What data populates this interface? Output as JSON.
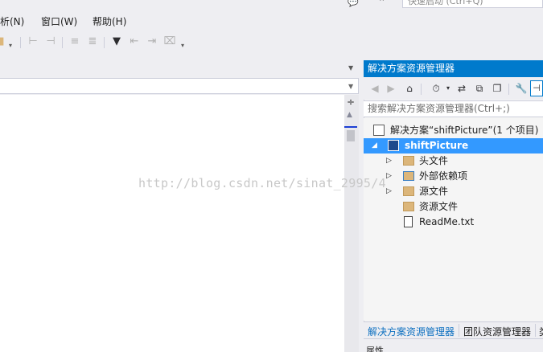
{
  "quick_launch": {
    "placeholder": "快速启动 (Ctrl+Q)"
  },
  "menu": [
    {
      "label": "析(N)"
    },
    {
      "label": "窗口(W)"
    },
    {
      "label": "帮助(H)"
    }
  ],
  "editor": {},
  "solution_explorer": {
    "title": "解决方案资源管理器",
    "search_placeholder": "搜索解决方案资源管理器(Ctrl+;)",
    "tree": [
      {
        "label": "解决方案“shiftPicture”(1 个项目)",
        "icon": "solution-icon"
      },
      {
        "label": "shiftPicture",
        "icon": "cpp-project-icon",
        "selected": true,
        "expanded": true
      },
      {
        "label": "头文件",
        "icon": "folder-icon",
        "expandable": true
      },
      {
        "label": "外部依赖项",
        "icon": "external-deps-icon",
        "expandable": true
      },
      {
        "label": "源文件",
        "icon": "folder-icon",
        "expandable": true
      },
      {
        "label": "资源文件",
        "icon": "folder-icon"
      },
      {
        "label": "ReadMe.txt",
        "icon": "text-file-icon"
      }
    ],
    "tabs": [
      {
        "label": "解决方案资源管理器",
        "active": true
      },
      {
        "label": "团队资源管理器"
      },
      {
        "label": "类"
      }
    ],
    "bottom_label": "属性"
  },
  "watermark": "http://blog.csdn.net/sinat_2995/4",
  "colors": {
    "accent": "#007acc",
    "selection": "#3399ff",
    "background": "#eeeef2",
    "active_tab": "#0e70c0"
  }
}
